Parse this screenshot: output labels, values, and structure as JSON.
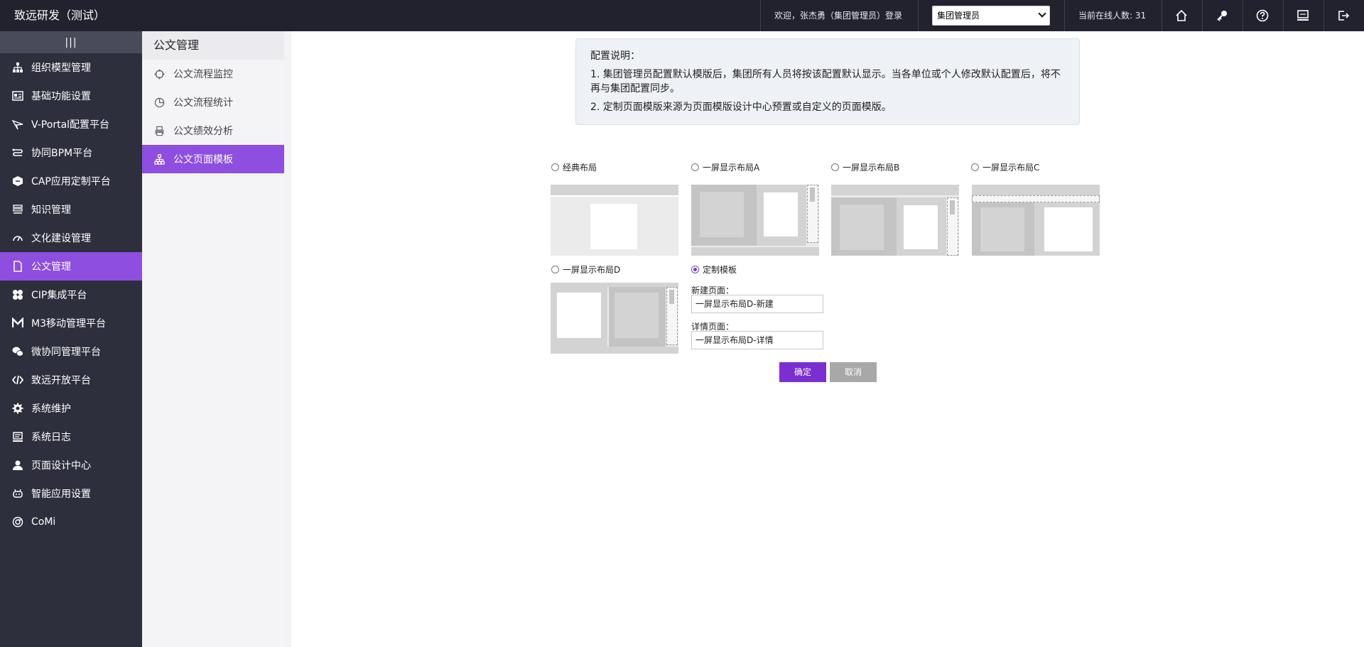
{
  "header": {
    "app_title": "致远研发（测试）",
    "welcome": "欢迎，张杰勇（集团管理员）登录",
    "role_select": "集团管理员",
    "online": "当前在线人数: 31",
    "icons": [
      "home-icon",
      "key-icon",
      "help-icon",
      "monitor-icon",
      "logout-icon"
    ]
  },
  "sidebar": {
    "collapse_icon": "|||",
    "items": [
      {
        "label": "组织模型管理",
        "icon": "org-tree-icon"
      },
      {
        "label": "基础功能设置",
        "icon": "id-card-icon"
      },
      {
        "label": "V-Portal配置平台",
        "icon": "paper-plane-icon"
      },
      {
        "label": "协同BPM平台",
        "icon": "flow-icon"
      },
      {
        "label": "CAP应用定制平台",
        "icon": "cube-icon"
      },
      {
        "label": "知识管理",
        "icon": "layers-icon"
      },
      {
        "label": "文化建设管理",
        "icon": "gauge-icon"
      },
      {
        "label": "公文管理",
        "icon": "document-icon"
      },
      {
        "label": "CIP集成平台",
        "icon": "puzzle-icon"
      },
      {
        "label": "M3移动管理平台",
        "icon": "m3-icon"
      },
      {
        "label": "微协同管理平台",
        "icon": "chat-icon"
      },
      {
        "label": "致远开放平台",
        "icon": "code-icon"
      },
      {
        "label": "系统维护",
        "icon": "gear-icon"
      },
      {
        "label": "系统日志",
        "icon": "monitor-log-icon"
      },
      {
        "label": "页面设计中心",
        "icon": "user-design-icon"
      },
      {
        "label": "智能应用设置",
        "icon": "robot-icon"
      },
      {
        "label": "CoMi",
        "icon": "comi-icon"
      }
    ],
    "active_index": 7
  },
  "submenu": {
    "title": "公文管理",
    "items": [
      {
        "label": "公文流程监控",
        "icon": "monitor-target-icon"
      },
      {
        "label": "公文流程统计",
        "icon": "pie-chart-icon"
      },
      {
        "label": "公文绩效分析",
        "icon": "printer-icon"
      },
      {
        "label": "公文页面模板",
        "icon": "sitemap-icon"
      }
    ],
    "active_index": 3
  },
  "info": {
    "title": "配置说明：",
    "line1": "1. 集团管理员配置默认模版后，集团所有人员将按该配置默认显示。当各单位或个人修改默认配置后，将不再与集团配置同步。",
    "line2": "2. 定制页面模版来源为页面模版设计中心预置或自定义的页面模版。"
  },
  "layouts": {
    "classic": "经典布局",
    "a": "一屏显示布局A",
    "b": "一屏显示布局B",
    "c": "一屏显示布局C",
    "d": "一屏显示布局D",
    "custom": "定制模板",
    "selected": "custom"
  },
  "custom": {
    "new_label": "新建页面：",
    "new_value": "一屏显示布局D-新建",
    "detail_label": "详情页面：",
    "detail_value": "一屏显示布局D-详情"
  },
  "buttons": {
    "ok": "确定",
    "cancel": "取消"
  }
}
